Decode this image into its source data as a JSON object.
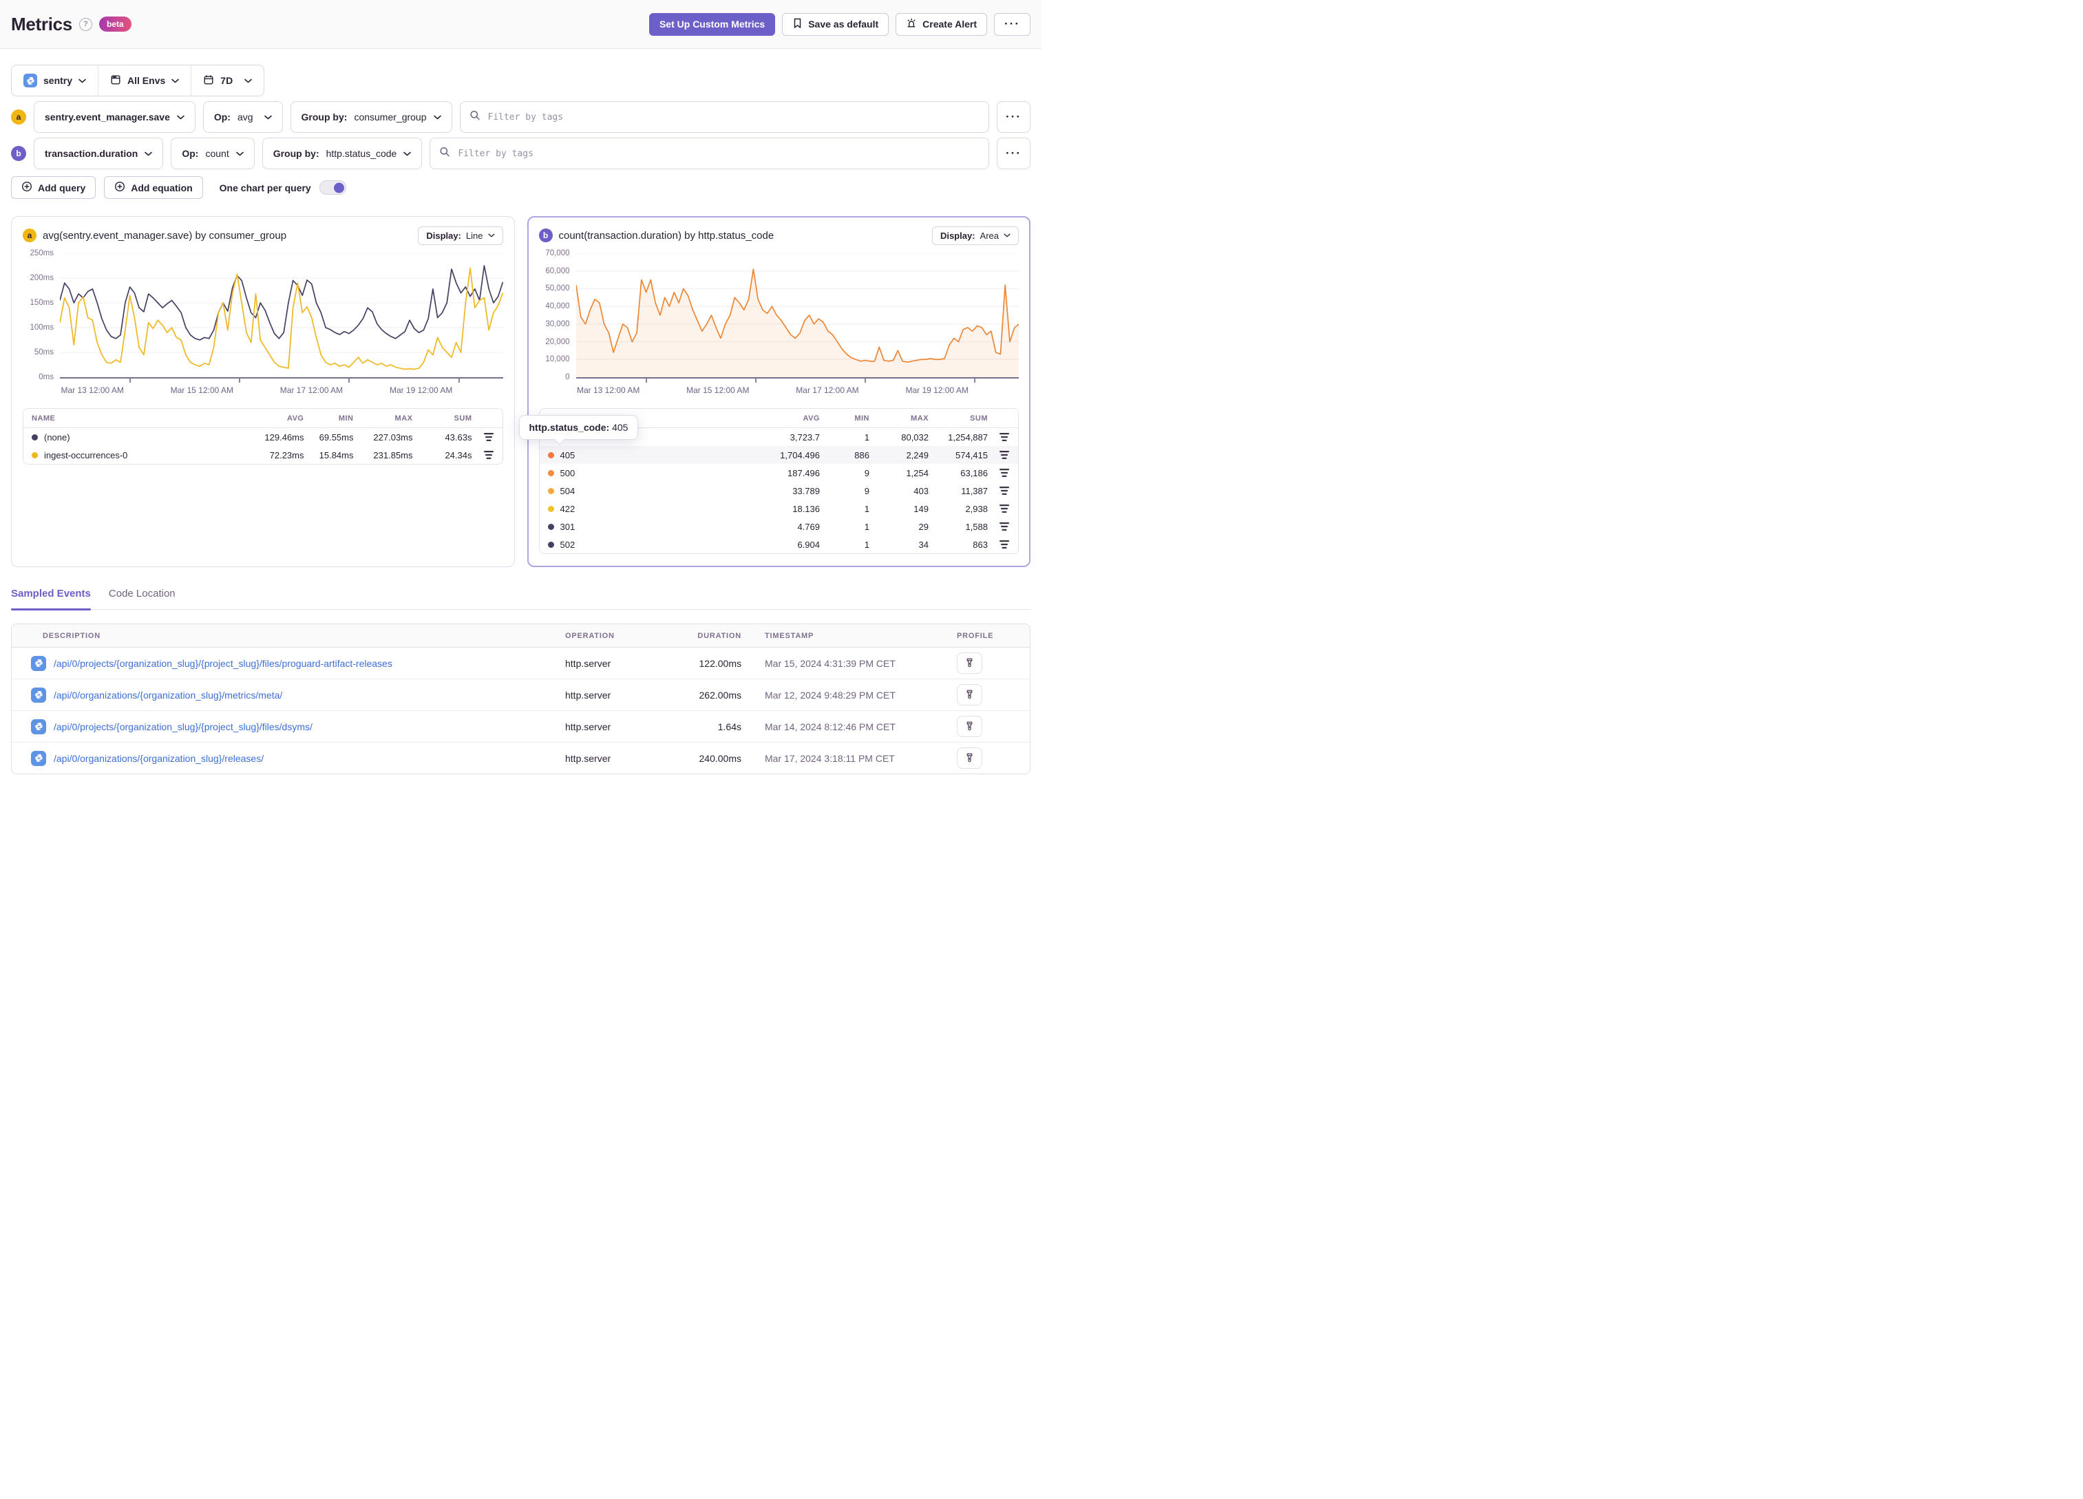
{
  "header": {
    "title": "Metrics",
    "beta_label": "beta",
    "setup_button": "Set Up Custom Metrics",
    "save_default_button": "Save as default",
    "create_alert_button": "Create Alert"
  },
  "scope_bar": {
    "project": "sentry",
    "environment": "All Envs",
    "date_range": "7D"
  },
  "queries": [
    {
      "badge": "a",
      "metric": "sentry.event_manager.save",
      "op_label": "Op:",
      "op": "avg",
      "groupby_label": "Group by:",
      "groupby": "consumer_group",
      "filter_placeholder": "Filter by tags"
    },
    {
      "badge": "b",
      "metric": "transaction.duration",
      "op_label": "Op:",
      "op": "count",
      "groupby_label": "Group by:",
      "groupby": "http.status_code",
      "filter_placeholder": "Filter by tags"
    }
  ],
  "actions": {
    "add_query": "Add query",
    "add_equation": "Add equation",
    "one_chart_toggle": "One chart per query"
  },
  "display_label": "Display:",
  "tooltip": {
    "label": "http.status_code:",
    "value": "405"
  },
  "tabs": [
    {
      "label": "Sampled Events",
      "active": true
    },
    {
      "label": "Code Location",
      "active": false
    }
  ],
  "chart_data": [
    {
      "type": "line",
      "badge": "a",
      "title": "avg(sentry.event_manager.save) by consumer_group",
      "display": "Line",
      "ylim": [
        0,
        250
      ],
      "yticks": [
        "0ms",
        "50ms",
        "100ms",
        "150ms",
        "200ms",
        "250ms"
      ],
      "xticks": [
        "Mar 13 12:00 AM",
        "Mar 15 12:00 AM",
        "Mar 17 12:00 AM",
        "Mar 19 12:00 AM"
      ],
      "grid": true,
      "legend_position": "table-below",
      "series": [
        {
          "name": "(none)",
          "color": "#443F63",
          "values": [
            155,
            190,
            178,
            150,
            168,
            160,
            173,
            178,
            150,
            118,
            95,
            82,
            78,
            85,
            150,
            182,
            170,
            140,
            132,
            168,
            160,
            150,
            140,
            148,
            155,
            143,
            130,
            100,
            85,
            78,
            75,
            80,
            78,
            95,
            130,
            150,
            133,
            180,
            205,
            195,
            160,
            130,
            120,
            150,
            135,
            110,
            88,
            78,
            90,
            150,
            195,
            185,
            165,
            196,
            188,
            150,
            130,
            100,
            96,
            90,
            86,
            92,
            88,
            95,
            105,
            118,
            140,
            132,
            108,
            96,
            88,
            82,
            78,
            85,
            92,
            115,
            98,
            90,
            95,
            118,
            178,
            120,
            130,
            150,
            218,
            190,
            170,
            182,
            163,
            178,
            155,
            225,
            178,
            150,
            163,
            192
          ]
        },
        {
          "name": "ingest-occurrences-0",
          "color": "#F0B71F",
          "values": [
            110,
            160,
            140,
            65,
            150,
            162,
            120,
            115,
            70,
            45,
            30,
            28,
            35,
            30,
            95,
            165,
            120,
            60,
            45,
            110,
            98,
            115,
            105,
            90,
            100,
            80,
            75,
            45,
            30,
            25,
            22,
            28,
            25,
            60,
            130,
            150,
            95,
            170,
            208,
            150,
            90,
            70,
            168,
            75,
            60,
            45,
            30,
            22,
            20,
            18,
            140,
            190,
            130,
            142,
            120,
            80,
            45,
            30,
            25,
            28,
            22,
            25,
            20,
            30,
            40,
            28,
            35,
            30,
            25,
            28,
            22,
            25,
            20,
            18,
            16,
            17,
            16,
            18,
            30,
            55,
            45,
            80,
            60,
            50,
            40,
            70,
            50,
            150,
            220,
            140,
            155,
            160,
            95,
            130,
            145,
            170
          ]
        }
      ],
      "summary": {
        "columns": [
          "NAME",
          "AVG",
          "MIN",
          "MAX",
          "SUM"
        ],
        "rows": [
          {
            "name": "(none)",
            "color": "#443F63",
            "avg": "129.46ms",
            "min": "69.55ms",
            "max": "227.03ms",
            "sum": "43.63s",
            "highlight": false
          },
          {
            "name": "ingest-occurrences-0",
            "color": "#F0B71F",
            "avg": "72.23ms",
            "min": "15.84ms",
            "max": "231.85ms",
            "sum": "24.34s",
            "highlight": false
          }
        ]
      }
    },
    {
      "type": "area",
      "badge": "b",
      "title": "count(transaction.duration) by http.status_code",
      "display": "Area",
      "ylim": [
        0,
        70000
      ],
      "yticks": [
        "0",
        "10,000",
        "20,000",
        "30,000",
        "40,000",
        "50,000",
        "60,000",
        "70,000"
      ],
      "xticks": [
        "Mar 13 12:00 AM",
        "Mar 15 12:00 AM",
        "Mar 17 12:00 AM",
        "Mar 19 12:00 AM"
      ],
      "grid": true,
      "legend_position": "table-below",
      "series": [
        {
          "name": "405",
          "color": "#ED8633",
          "fill": "rgba(237,134,60,0.10)",
          "values": [
            52000,
            34000,
            30000,
            38000,
            44000,
            42000,
            30000,
            25000,
            14000,
            22000,
            30000,
            28000,
            20000,
            25000,
            55000,
            48000,
            55000,
            42000,
            35000,
            45000,
            40000,
            48000,
            42000,
            50000,
            46000,
            38000,
            32000,
            26000,
            30000,
            35000,
            28000,
            22000,
            30000,
            35000,
            45000,
            42000,
            38000,
            44000,
            61000,
            44000,
            38000,
            36000,
            40000,
            35000,
            32000,
            28000,
            24000,
            22000,
            25000,
            32000,
            35000,
            30000,
            33000,
            31000,
            26000,
            24000,
            20000,
            16000,
            13000,
            11000,
            10000,
            9000,
            9500,
            9000,
            9000,
            17000,
            9500,
            9000,
            9500,
            15000,
            9000,
            8500,
            9000,
            9500,
            10000,
            10000,
            10500,
            10000,
            10000,
            10500,
            18000,
            22000,
            20000,
            27000,
            28000,
            26000,
            29000,
            28000,
            24000,
            26000,
            14000,
            13000,
            52000,
            20000,
            28000,
            30000
          ]
        }
      ],
      "summary": {
        "columns": [
          "NAME",
          "AVG",
          "MIN",
          "MAX",
          "SUM"
        ],
        "rows": [
          {
            "name": "",
            "color": "",
            "avg": "3,723.7",
            "min": "1",
            "max": "80,032",
            "sum": "1,254,887",
            "highlight": false
          },
          {
            "name": "405",
            "color": "#F2793F",
            "avg": "1,704.496",
            "min": "886",
            "max": "2,249",
            "sum": "574,415",
            "highlight": true
          },
          {
            "name": "500",
            "color": "#F58A3D",
            "avg": "187.496",
            "min": "9",
            "max": "1,254",
            "sum": "63,186",
            "highlight": false
          },
          {
            "name": "504",
            "color": "#F5A83B",
            "avg": "33.789",
            "min": "9",
            "max": "403",
            "sum": "11,387",
            "highlight": false
          },
          {
            "name": "422",
            "color": "#EFC228",
            "avg": "18.136",
            "min": "1",
            "max": "149",
            "sum": "2,938",
            "highlight": false
          },
          {
            "name": "301",
            "color": "#443F63",
            "avg": "4.769",
            "min": "1",
            "max": "29",
            "sum": "1,588",
            "highlight": false
          },
          {
            "name": "502",
            "color": "#443F63",
            "avg": "6.904",
            "min": "1",
            "max": "34",
            "sum": "863",
            "highlight": false
          }
        ]
      }
    }
  ],
  "sampled_events": {
    "columns": [
      "DESCRIPTION",
      "OPERATION",
      "DURATION",
      "TIMESTAMP",
      "PROFILE"
    ],
    "rows": [
      {
        "description": "/api/0/projects/{organization_slug}/{project_slug}/files/proguard-artifact-releases",
        "operation": "http.server",
        "duration": "122.00ms",
        "timestamp": "Mar 15, 2024 4:31:39 PM CET"
      },
      {
        "description": "/api/0/organizations/{organization_slug}/metrics/meta/",
        "operation": "http.server",
        "duration": "262.00ms",
        "timestamp": "Mar 12, 2024 9:48:29 PM CET"
      },
      {
        "description": "/api/0/projects/{organization_slug}/{project_slug}/files/dsyms/",
        "operation": "http.server",
        "duration": "1.64s",
        "timestamp": "Mar 14, 2024 8:12:46 PM CET"
      },
      {
        "description": "/api/0/organizations/{organization_slug}/releases/",
        "operation": "http.server",
        "duration": "240.00ms",
        "timestamp": "Mar 17, 2024 3:18:11 PM CET"
      }
    ]
  },
  "colors": {
    "accent": "#6C5FC7",
    "selected_panel_border": "#AFA6E2",
    "link": "#3C6FD6",
    "axis": "#7A6E8F"
  }
}
